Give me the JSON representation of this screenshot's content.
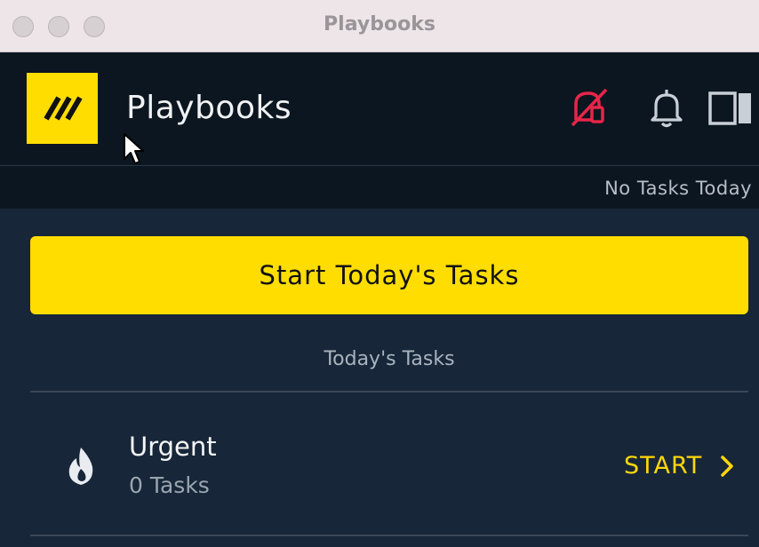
{
  "window": {
    "title": "Playbooks"
  },
  "header": {
    "app_title": "Playbooks",
    "icons": [
      "logo-icon",
      "notification-muted-icon",
      "bell-icon",
      "panel-toggle-icon"
    ],
    "accent_color": "#ffdd00",
    "alert_color": "#e8254a"
  },
  "status": {
    "text": "No Tasks Today"
  },
  "main": {
    "start_button_label": "Start Today's Tasks",
    "section_label": "Today's Tasks",
    "tasks": [
      {
        "title": "Urgent",
        "count_label": "0 Tasks",
        "action_label": "START",
        "icon": "flame-icon"
      }
    ]
  }
}
